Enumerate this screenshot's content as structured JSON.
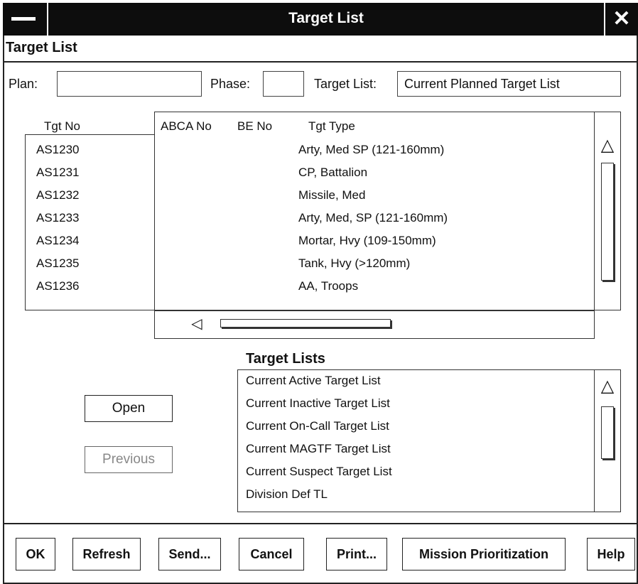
{
  "window": {
    "title": "Target List",
    "close_glyph": "✕",
    "menu_icon": "window-menu-icon"
  },
  "section": {
    "title": "Target List"
  },
  "filters": {
    "plan_label": "Plan:",
    "plan_value": "",
    "phase_label": "Phase:",
    "phase_value": "",
    "target_list_label": "Target List:",
    "target_list_value": "Current Planned Target List"
  },
  "table": {
    "headers": {
      "tgt_no": "Tgt No",
      "abca_no": "ABCA No",
      "be_no": "BE No",
      "tgt_type": "Tgt Type"
    },
    "rows": [
      {
        "tgt_no": "AS1230",
        "abca_no": "",
        "be_no": "",
        "tgt_type": "Arty, Med SP (121-160mm)"
      },
      {
        "tgt_no": "AS1231",
        "abca_no": "",
        "be_no": "",
        "tgt_type": "CP, Battalion"
      },
      {
        "tgt_no": "AS1232",
        "abca_no": "",
        "be_no": "",
        "tgt_type": "Missile, Med"
      },
      {
        "tgt_no": "AS1233",
        "abca_no": "",
        "be_no": "",
        "tgt_type": "Arty, Med, SP (121-160mm)"
      },
      {
        "tgt_no": "AS1234",
        "abca_no": "",
        "be_no": "",
        "tgt_type": "Mortar, Hvy (109-150mm)"
      },
      {
        "tgt_no": "AS1235",
        "abca_no": "",
        "be_no": "",
        "tgt_type": "Tank, Hvy (>120mm)"
      },
      {
        "tgt_no": "AS1236",
        "abca_no": "",
        "be_no": "",
        "tgt_type": "AA, Troops"
      }
    ],
    "scroll_up_glyph": "△",
    "scroll_left_glyph": "◁"
  },
  "side_buttons": {
    "open": "Open",
    "previous": "Previous"
  },
  "target_lists": {
    "title": "Target Lists",
    "items": [
      "Current Active Target List",
      "Current Inactive Target List",
      "Current On-Call Target List",
      "Current MAGTF Target List",
      "Current Suspect Target List",
      "Division Def TL"
    ],
    "scroll_up_glyph": "△"
  },
  "footer": {
    "ok": "OK",
    "refresh": "Refresh",
    "send": "Send...",
    "cancel": "Cancel",
    "print": "Print...",
    "mission_prioritization": "Mission Prioritization",
    "help": "Help"
  }
}
